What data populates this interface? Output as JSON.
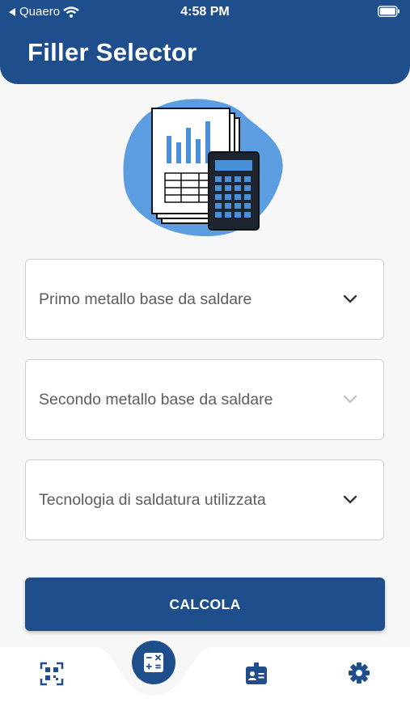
{
  "status_bar": {
    "carrier": "Quaero",
    "time": "4:58 PM"
  },
  "header": {
    "title": "Filler Selector"
  },
  "form": {
    "selects": [
      {
        "label": "Primo metallo base da saldare",
        "enabled": true
      },
      {
        "label": "Secondo metallo base da saldare",
        "enabled": false
      },
      {
        "label": "Tecnologia di saldatura utilizzata",
        "enabled": true
      }
    ],
    "submit_label": "CALCOLA"
  },
  "bottom_nav": {
    "items": [
      {
        "icon": "qr-code-icon",
        "active": false
      },
      {
        "icon": "calculator-icon",
        "active": true
      },
      {
        "icon": "id-badge-icon",
        "active": false
      },
      {
        "icon": "gear-icon",
        "active": false
      }
    ]
  },
  "colors": {
    "primary": "#1f4e8c",
    "background": "#f7f7f7",
    "illustration_blob": "#5b9de0"
  }
}
